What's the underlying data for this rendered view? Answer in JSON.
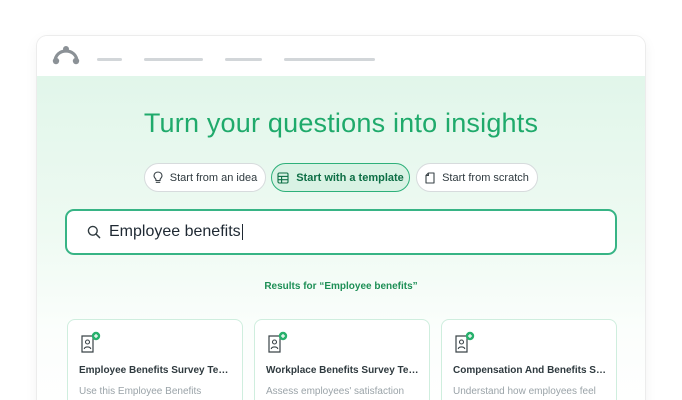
{
  "app": {
    "logo_icon": "surveymonkey-logo-icon"
  },
  "nav": {
    "placeholder_lines": 4
  },
  "hero": {
    "headline": "Turn your questions into insights"
  },
  "options": [
    {
      "label": "Start from an idea",
      "icon": "lightbulb-icon",
      "active": false
    },
    {
      "label": "Start with a template",
      "icon": "table-icon",
      "active": true
    },
    {
      "label": "Start from scratch",
      "icon": "document-icon",
      "active": false
    }
  ],
  "search": {
    "value": "Employee benefits",
    "icon": "search-icon"
  },
  "results": {
    "label": "Results for “Employee benefits”",
    "cards": [
      {
        "title": "Employee Benefits Survey Tem...",
        "description": "Use this Employee Benefits",
        "icon": "survey-template-icon"
      },
      {
        "title": "Workplace Benefits Survey Tem...",
        "description": "Assess employees' satisfaction",
        "icon": "survey-template-icon"
      },
      {
        "title": "Compensation And Benefits Su...",
        "description": "Understand how employees feel",
        "icon": "survey-template-icon"
      }
    ]
  },
  "colors": {
    "brand_green": "#1faa6b",
    "active_pill_bg": "#d9f2e4",
    "search_border": "#37b485",
    "results_label": "#1e8f56"
  }
}
